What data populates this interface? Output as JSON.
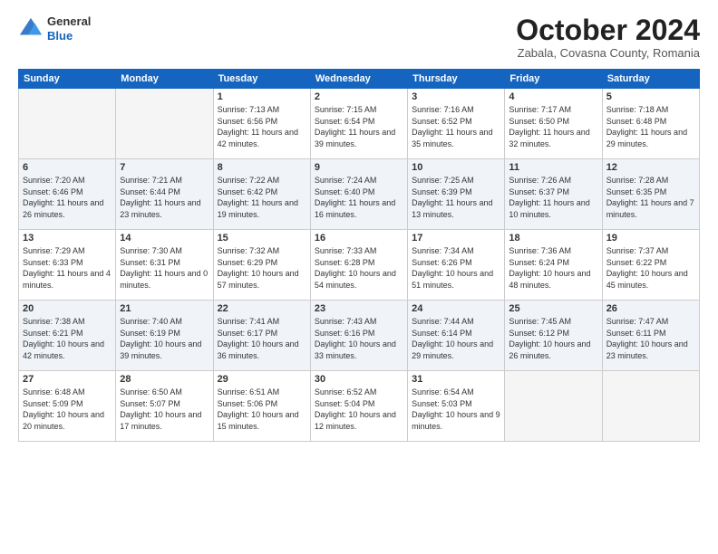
{
  "logo": {
    "general": "General",
    "blue": "Blue"
  },
  "header": {
    "month": "October 2024",
    "location": "Zabala, Covasna County, Romania"
  },
  "days_of_week": [
    "Sunday",
    "Monday",
    "Tuesday",
    "Wednesday",
    "Thursday",
    "Friday",
    "Saturday"
  ],
  "weeks": [
    [
      {
        "day": "",
        "sunrise": "",
        "sunset": "",
        "daylight": "",
        "empty": true
      },
      {
        "day": "",
        "sunrise": "",
        "sunset": "",
        "daylight": "",
        "empty": true
      },
      {
        "day": "1",
        "sunrise": "Sunrise: 7:13 AM",
        "sunset": "Sunset: 6:56 PM",
        "daylight": "Daylight: 11 hours and 42 minutes."
      },
      {
        "day": "2",
        "sunrise": "Sunrise: 7:15 AM",
        "sunset": "Sunset: 6:54 PM",
        "daylight": "Daylight: 11 hours and 39 minutes."
      },
      {
        "day": "3",
        "sunrise": "Sunrise: 7:16 AM",
        "sunset": "Sunset: 6:52 PM",
        "daylight": "Daylight: 11 hours and 35 minutes."
      },
      {
        "day": "4",
        "sunrise": "Sunrise: 7:17 AM",
        "sunset": "Sunset: 6:50 PM",
        "daylight": "Daylight: 11 hours and 32 minutes."
      },
      {
        "day": "5",
        "sunrise": "Sunrise: 7:18 AM",
        "sunset": "Sunset: 6:48 PM",
        "daylight": "Daylight: 11 hours and 29 minutes."
      }
    ],
    [
      {
        "day": "6",
        "sunrise": "Sunrise: 7:20 AM",
        "sunset": "Sunset: 6:46 PM",
        "daylight": "Daylight: 11 hours and 26 minutes."
      },
      {
        "day": "7",
        "sunrise": "Sunrise: 7:21 AM",
        "sunset": "Sunset: 6:44 PM",
        "daylight": "Daylight: 11 hours and 23 minutes."
      },
      {
        "day": "8",
        "sunrise": "Sunrise: 7:22 AM",
        "sunset": "Sunset: 6:42 PM",
        "daylight": "Daylight: 11 hours and 19 minutes."
      },
      {
        "day": "9",
        "sunrise": "Sunrise: 7:24 AM",
        "sunset": "Sunset: 6:40 PM",
        "daylight": "Daylight: 11 hours and 16 minutes."
      },
      {
        "day": "10",
        "sunrise": "Sunrise: 7:25 AM",
        "sunset": "Sunset: 6:39 PM",
        "daylight": "Daylight: 11 hours and 13 minutes."
      },
      {
        "day": "11",
        "sunrise": "Sunrise: 7:26 AM",
        "sunset": "Sunset: 6:37 PM",
        "daylight": "Daylight: 11 hours and 10 minutes."
      },
      {
        "day": "12",
        "sunrise": "Sunrise: 7:28 AM",
        "sunset": "Sunset: 6:35 PM",
        "daylight": "Daylight: 11 hours and 7 minutes."
      }
    ],
    [
      {
        "day": "13",
        "sunrise": "Sunrise: 7:29 AM",
        "sunset": "Sunset: 6:33 PM",
        "daylight": "Daylight: 11 hours and 4 minutes."
      },
      {
        "day": "14",
        "sunrise": "Sunrise: 7:30 AM",
        "sunset": "Sunset: 6:31 PM",
        "daylight": "Daylight: 11 hours and 0 minutes."
      },
      {
        "day": "15",
        "sunrise": "Sunrise: 7:32 AM",
        "sunset": "Sunset: 6:29 PM",
        "daylight": "Daylight: 10 hours and 57 minutes."
      },
      {
        "day": "16",
        "sunrise": "Sunrise: 7:33 AM",
        "sunset": "Sunset: 6:28 PM",
        "daylight": "Daylight: 10 hours and 54 minutes."
      },
      {
        "day": "17",
        "sunrise": "Sunrise: 7:34 AM",
        "sunset": "Sunset: 6:26 PM",
        "daylight": "Daylight: 10 hours and 51 minutes."
      },
      {
        "day": "18",
        "sunrise": "Sunrise: 7:36 AM",
        "sunset": "Sunset: 6:24 PM",
        "daylight": "Daylight: 10 hours and 48 minutes."
      },
      {
        "day": "19",
        "sunrise": "Sunrise: 7:37 AM",
        "sunset": "Sunset: 6:22 PM",
        "daylight": "Daylight: 10 hours and 45 minutes."
      }
    ],
    [
      {
        "day": "20",
        "sunrise": "Sunrise: 7:38 AM",
        "sunset": "Sunset: 6:21 PM",
        "daylight": "Daylight: 10 hours and 42 minutes."
      },
      {
        "day": "21",
        "sunrise": "Sunrise: 7:40 AM",
        "sunset": "Sunset: 6:19 PM",
        "daylight": "Daylight: 10 hours and 39 minutes."
      },
      {
        "day": "22",
        "sunrise": "Sunrise: 7:41 AM",
        "sunset": "Sunset: 6:17 PM",
        "daylight": "Daylight: 10 hours and 36 minutes."
      },
      {
        "day": "23",
        "sunrise": "Sunrise: 7:43 AM",
        "sunset": "Sunset: 6:16 PM",
        "daylight": "Daylight: 10 hours and 33 minutes."
      },
      {
        "day": "24",
        "sunrise": "Sunrise: 7:44 AM",
        "sunset": "Sunset: 6:14 PM",
        "daylight": "Daylight: 10 hours and 29 minutes."
      },
      {
        "day": "25",
        "sunrise": "Sunrise: 7:45 AM",
        "sunset": "Sunset: 6:12 PM",
        "daylight": "Daylight: 10 hours and 26 minutes."
      },
      {
        "day": "26",
        "sunrise": "Sunrise: 7:47 AM",
        "sunset": "Sunset: 6:11 PM",
        "daylight": "Daylight: 10 hours and 23 minutes."
      }
    ],
    [
      {
        "day": "27",
        "sunrise": "Sunrise: 6:48 AM",
        "sunset": "Sunset: 5:09 PM",
        "daylight": "Daylight: 10 hours and 20 minutes."
      },
      {
        "day": "28",
        "sunrise": "Sunrise: 6:50 AM",
        "sunset": "Sunset: 5:07 PM",
        "daylight": "Daylight: 10 hours and 17 minutes."
      },
      {
        "day": "29",
        "sunrise": "Sunrise: 6:51 AM",
        "sunset": "Sunset: 5:06 PM",
        "daylight": "Daylight: 10 hours and 15 minutes."
      },
      {
        "day": "30",
        "sunrise": "Sunrise: 6:52 AM",
        "sunset": "Sunset: 5:04 PM",
        "daylight": "Daylight: 10 hours and 12 minutes."
      },
      {
        "day": "31",
        "sunrise": "Sunrise: 6:54 AM",
        "sunset": "Sunset: 5:03 PM",
        "daylight": "Daylight: 10 hours and 9 minutes."
      },
      {
        "day": "",
        "sunrise": "",
        "sunset": "",
        "daylight": "",
        "empty": true
      },
      {
        "day": "",
        "sunrise": "",
        "sunset": "",
        "daylight": "",
        "empty": true
      }
    ]
  ]
}
